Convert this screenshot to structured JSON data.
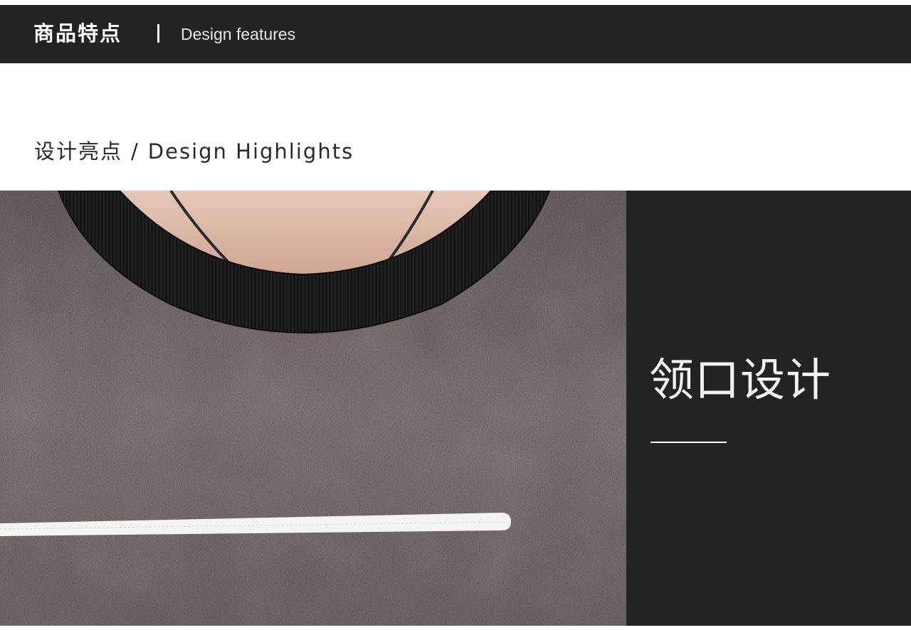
{
  "header": {
    "title_cn": "商品特点",
    "title_en": "Design features"
  },
  "section": {
    "title_cn": "设计亮点",
    "separator": "/",
    "title_en": "Design Highlights"
  },
  "feature": {
    "label": "领口设计",
    "image_icon": "sweater-collar-photo"
  },
  "colors": {
    "dark_bar": "#242323",
    "sweater": "#7d7170",
    "collar": "#141414",
    "trim": "#f4f4f4"
  }
}
